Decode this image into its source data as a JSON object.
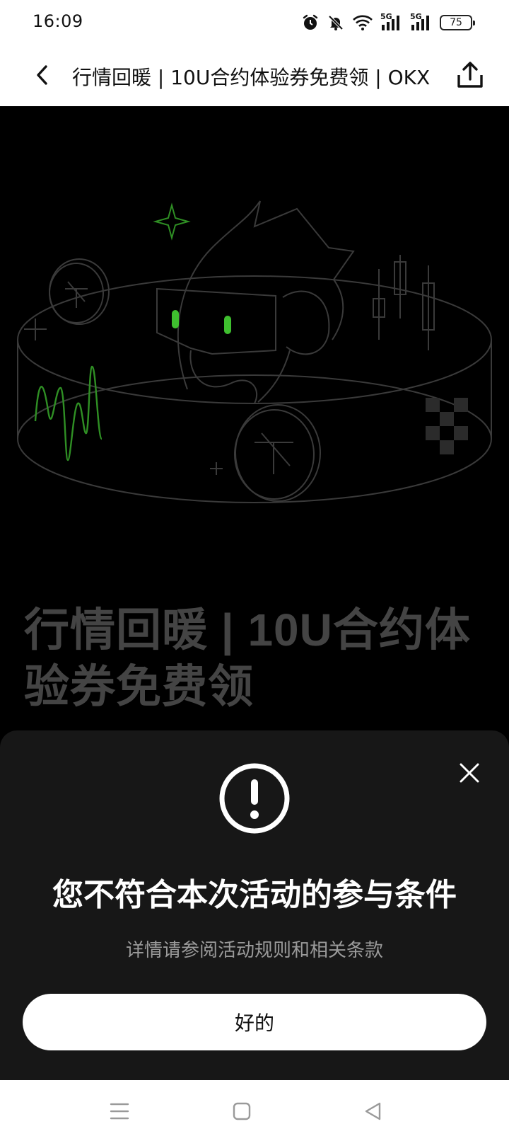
{
  "status_bar": {
    "time": "16:09",
    "icons": [
      "alarm-icon",
      "mute-icon",
      "wifi-icon",
      "signal-5g-icon",
      "signal-5g-icon",
      "battery-icon"
    ],
    "network_label_1": "5G",
    "network_label_2": "5G",
    "battery": "75"
  },
  "nav_bar": {
    "title": "行情回暖 | 10U合约体验券免费领 | OKX",
    "back_icon": "chevron-left-icon",
    "share_icon": "share-icon"
  },
  "page": {
    "heading_line1": "行情回暖 | 10U合约体",
    "heading_line2": "验券免费领"
  },
  "dialog": {
    "icon": "exclamation-circle-icon",
    "title": "您不符合本次活动的参与条件",
    "subtitle": "详情请参阅活动规则和相关条款",
    "ok_label": "好的",
    "close_icon": "close-icon"
  },
  "system_nav": {
    "icons": [
      "menu-icon",
      "home-square-icon",
      "back-triangle-icon"
    ]
  },
  "colors": {
    "accent_green": "#3fbf2f",
    "sheet_bg": "#171717",
    "heading_gray": "#444444"
  }
}
